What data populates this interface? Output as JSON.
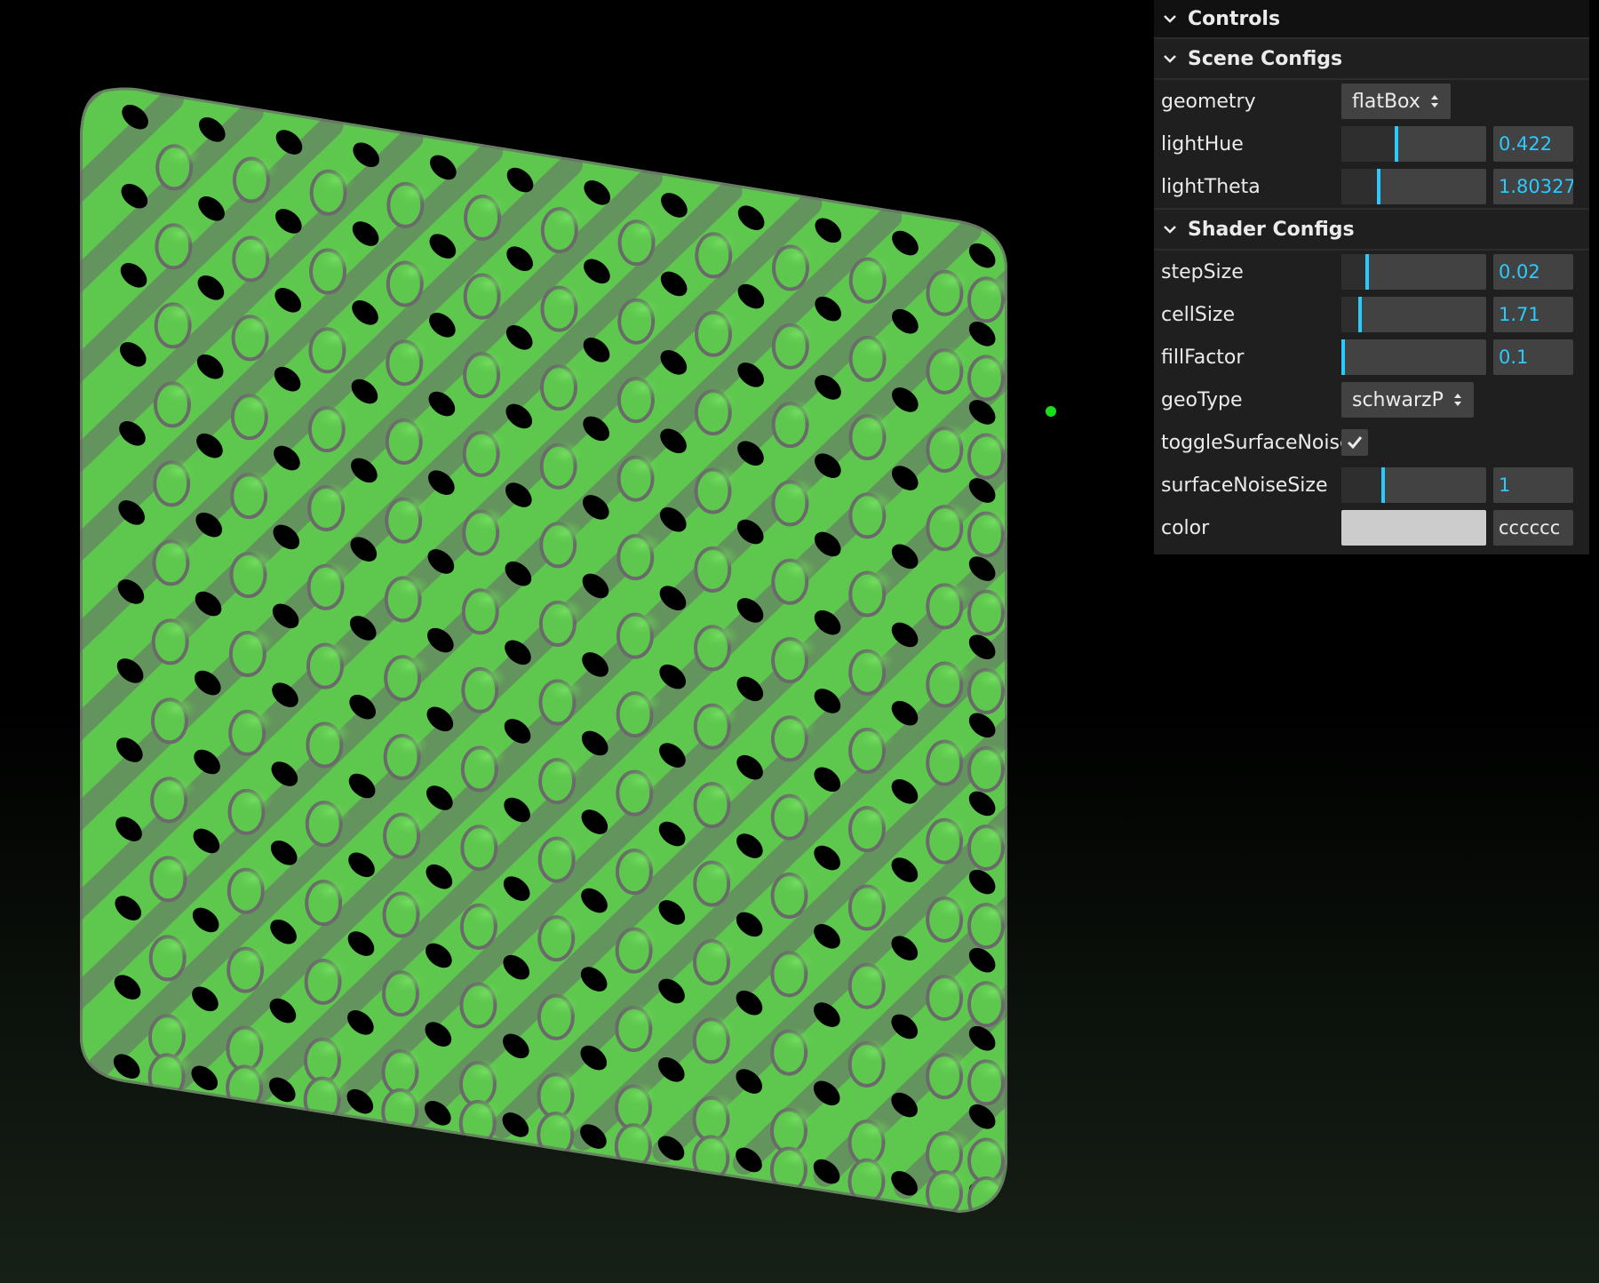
{
  "gui": {
    "title": "Controls",
    "folders": {
      "scene": {
        "title": "Scene Configs",
        "geometry": {
          "label": "geometry",
          "value": "flatBox"
        },
        "lightHue": {
          "label": "lightHue",
          "value": "0.422",
          "fraction": 0.38
        },
        "lightTheta": {
          "label": "lightTheta",
          "value": "1.803274",
          "fraction": 0.25
        }
      },
      "shader": {
        "title": "Shader Configs",
        "stepSize": {
          "label": "stepSize",
          "value": "0.02",
          "fraction": 0.17
        },
        "cellSize": {
          "label": "cellSize",
          "value": "1.71",
          "fraction": 0.12
        },
        "fillFactor": {
          "label": "fillFactor",
          "value": "0.1",
          "fraction": 0.0
        },
        "geoType": {
          "label": "geoType",
          "value": "schwarzP"
        },
        "toggleSurfaceNoise": {
          "label": "toggleSurfaceNoise",
          "checked": true
        },
        "surfaceNoiseSize": {
          "label": "surfaceNoiseSize",
          "value": "1",
          "fraction": 0.28
        },
        "color": {
          "label": "color",
          "value": "cccccc",
          "swatch": "#cccccc"
        }
      }
    }
  },
  "colors": {
    "accent": "#2cc9ff",
    "surfaceGreen": "#5ec84e",
    "surfaceGray": "#6a6a6a",
    "lightDot": "#18e018"
  },
  "scene": {
    "light_indicator": "green-dot-icon",
    "lattice_cols": 11,
    "lattice_rows": 12
  }
}
